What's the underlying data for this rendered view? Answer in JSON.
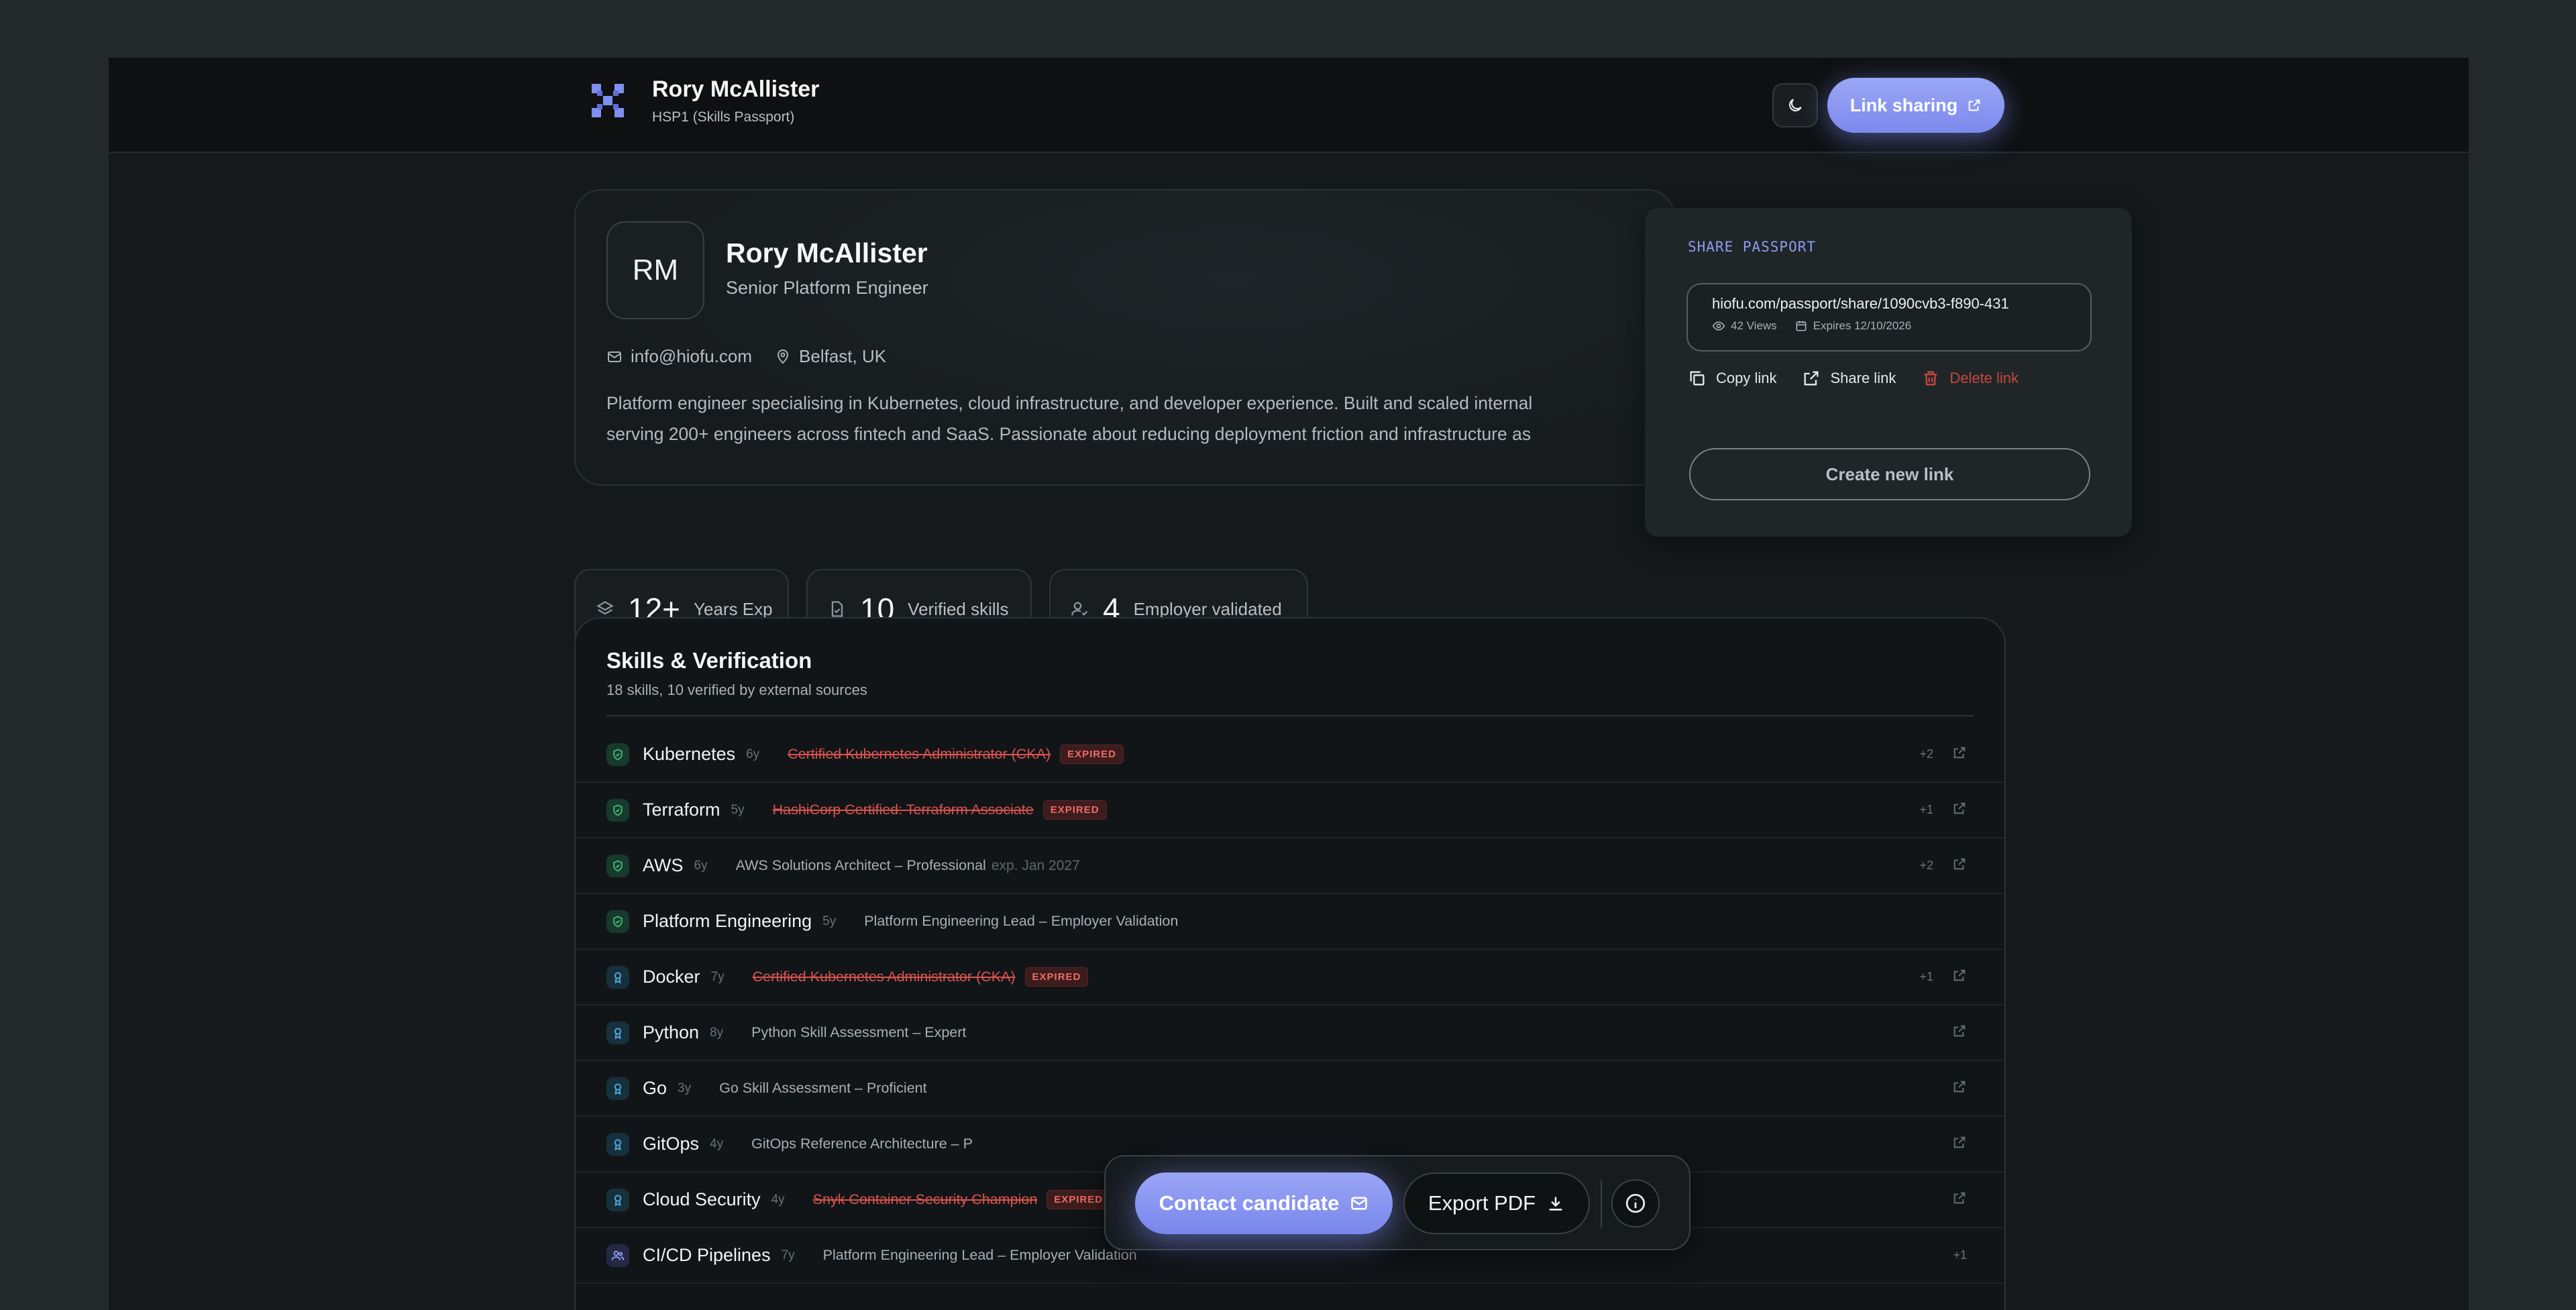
{
  "header": {
    "name": "Rory McAllister",
    "subtitle": "HSP1 (Skills Passport)",
    "link_sharing_label": "Link sharing"
  },
  "profile": {
    "initials": "RM",
    "name": "Rory McAllister",
    "title": "Senior Platform Engineer",
    "email": "info@hiofu.com",
    "location": "Belfast, UK",
    "bio_line1": "Platform engineer specialising in Kubernetes, cloud infrastructure, and developer experience. Built and scaled internal",
    "bio_line2": "serving 200+ engineers across fintech and SaaS. Passionate about reducing deployment friction and infrastructure as"
  },
  "stats": [
    {
      "value": "12+",
      "label": "Years Exp",
      "icon": "layers-icon"
    },
    {
      "value": "10",
      "label": "Verified skills",
      "icon": "document-check-icon"
    },
    {
      "value": "4",
      "label": "Employer validated",
      "icon": "user-check-icon"
    }
  ],
  "skills": {
    "title": "Skills & Verification",
    "subtitle": "18 skills, 10 verified by external sources",
    "expired_badge": "EXPIRED",
    "rows": [
      {
        "name": "Kubernetes",
        "years": "6y",
        "cert": "Certified Kubernetes Administrator (CKA)",
        "expired": true,
        "exp": "",
        "count": "+2",
        "icon": "shield-check-icon",
        "tone": "green"
      },
      {
        "name": "Terraform",
        "years": "5y",
        "cert": "HashiCorp Certified: Terraform Associate",
        "expired": true,
        "exp": "",
        "count": "+1",
        "icon": "shield-check-icon",
        "tone": "green"
      },
      {
        "name": "AWS",
        "years": "6y",
        "cert": "AWS Solutions Architect – Professional",
        "expired": false,
        "exp": "exp. Jan 2027",
        "count": "+2",
        "icon": "shield-check-icon",
        "tone": "green"
      },
      {
        "name": "Platform Engineering",
        "years": "5y",
        "cert": "Platform Engineering Lead – Employer Validation",
        "expired": false,
        "exp": "",
        "count": "",
        "icon": "shield-check-icon",
        "tone": "green"
      },
      {
        "name": "Docker",
        "years": "7y",
        "cert": "Certified Kubernetes Administrator (CKA)",
        "expired": true,
        "exp": "",
        "count": "+1",
        "icon": "award-icon",
        "tone": "blue"
      },
      {
        "name": "Python",
        "years": "8y",
        "cert": "Python Skill Assessment – Expert",
        "expired": false,
        "exp": "",
        "count": "",
        "icon": "award-icon",
        "tone": "blue"
      },
      {
        "name": "Go",
        "years": "3y",
        "cert": "Go Skill Assessment – Proficient",
        "expired": false,
        "exp": "",
        "count": "",
        "icon": "award-icon",
        "tone": "blue"
      },
      {
        "name": "GitOps",
        "years": "4y",
        "cert": "GitOps Reference Architecture – P",
        "expired": false,
        "exp": "",
        "count": "",
        "icon": "award-icon",
        "tone": "blue"
      },
      {
        "name": "Cloud Security",
        "years": "4y",
        "cert": "Snyk Container Security Champion",
        "expired": true,
        "exp": "",
        "count": "",
        "icon": "award-icon",
        "tone": "blue"
      },
      {
        "name": "CI/CD Pipelines",
        "years": "7y",
        "cert": "Platform Engineering Lead – Employer Validation",
        "expired": false,
        "exp": "",
        "count": "+1",
        "icon": "users-icon",
        "tone": "violet"
      }
    ]
  },
  "share_popover": {
    "heading": "SHARE PASSPORT",
    "url": "hiofu.com/passport/share/1090cvb3-f890-431",
    "views": "42 Views",
    "expires": "Expires 12/10/2026",
    "copy_label": "Copy link",
    "share_label": "Share link",
    "delete_label": "Delete link",
    "create_label": "Create new link"
  },
  "action_bar": {
    "contact_label": "Contact candidate",
    "export_label": "Export PDF"
  },
  "colors": {
    "accent": "#8c9cf0",
    "danger": "#d9534f",
    "verified": "#3fb47a"
  }
}
